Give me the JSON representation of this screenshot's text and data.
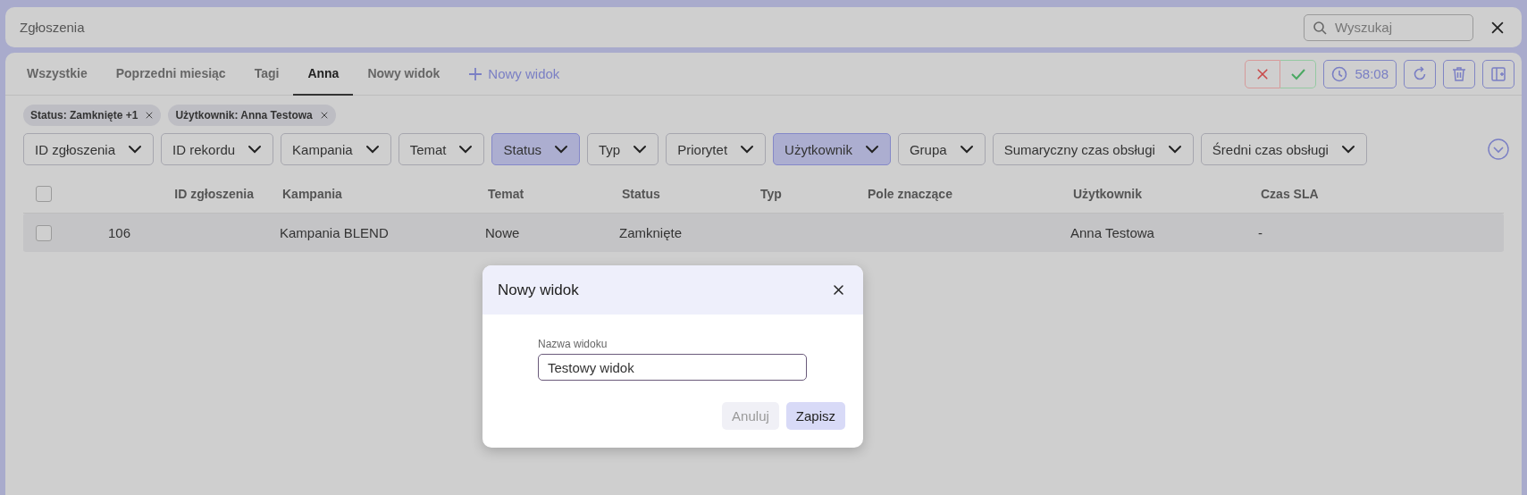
{
  "header": {
    "title": "Zgłoszenia",
    "search": {
      "placeholder": "Wyszukaj"
    }
  },
  "tabs": [
    {
      "label": "Wszystkie",
      "selected": false
    },
    {
      "label": "Poprzedni miesiąc",
      "selected": false
    },
    {
      "label": "Tagi",
      "selected": false
    },
    {
      "label": "Anna",
      "selected": true
    },
    {
      "label": "Nowy widok",
      "selected": false
    }
  ],
  "add_tab": {
    "label": "Nowy widok"
  },
  "toolbar": {
    "timer": "58:08"
  },
  "active_filters": [
    {
      "label": "Status: Zamknięte +1"
    },
    {
      "label": "Użytkownik: Anna Testowa"
    }
  ],
  "filters": [
    {
      "label": "ID zgłoszenia",
      "selected": false
    },
    {
      "label": "ID rekordu",
      "selected": false
    },
    {
      "label": "Kampania",
      "selected": false
    },
    {
      "label": "Temat",
      "selected": false
    },
    {
      "label": "Status",
      "selected": true
    },
    {
      "label": "Typ",
      "selected": false
    },
    {
      "label": "Priorytet",
      "selected": false
    },
    {
      "label": "Użytkownik",
      "selected": true
    },
    {
      "label": "Grupa",
      "selected": false
    },
    {
      "label": "Sumaryczny czas obsługi",
      "selected": false
    },
    {
      "label": "Średni czas obsługi",
      "selected": false
    }
  ],
  "table": {
    "header_checked": false,
    "columns": [
      "ID zgłoszenia",
      "Kampania",
      "Temat",
      "Status",
      "Typ",
      "Pole znaczące",
      "Użytkownik",
      "Czas SLA"
    ],
    "rows": [
      {
        "checked": false,
        "cells": [
          "106",
          "Kampania BLEND",
          "Nowe",
          "Zamknięte",
          null,
          null,
          "Anna Testowa",
          "-"
        ]
      }
    ]
  },
  "dialog": {
    "title": "Nowy widok",
    "field": {
      "label": "Nazwa widoku",
      "value": "Testowy widok"
    },
    "buttons": [
      {
        "label": "Anuluj",
        "kind": "secondary"
      },
      {
        "label": "Zapisz",
        "kind": "primary"
      }
    ]
  }
}
